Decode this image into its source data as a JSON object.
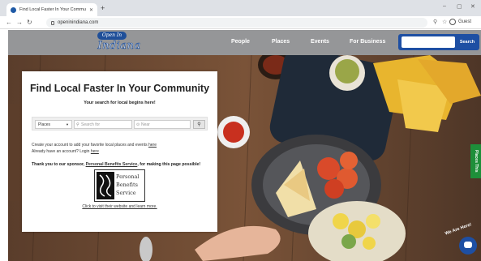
{
  "browser": {
    "tab_title": "Find Local Faster In Your Commu",
    "url": "openinindiana.com",
    "profile_label": "Guest"
  },
  "site": {
    "logo_top": "Open In",
    "logo_word": "Indiana",
    "nav": [
      "People",
      "Places",
      "Events",
      "For Business"
    ],
    "search_placeholder": "",
    "search_button": "Search"
  },
  "card": {
    "title": "Find Local Faster In Your Community",
    "subtitle": "Your search for local begins here!",
    "filter_select": "Places",
    "search_for_placeholder": "Search for",
    "near_placeholder": "Near",
    "info_line1": "Create your account to add your favorite local places and events",
    "info_line1_link": "here",
    "info_line2": "Already have an account? Login",
    "info_line2_link": "here",
    "sponsor_prefix": "Thank you to our sponsor,",
    "sponsor_name": "Personal Benefits Service",
    "sponsor_suffix": ", for making this page possible!",
    "sponsor_logo_lines": [
      "Personal",
      "Benefits",
      "Service"
    ],
    "visit_link": "Click to visit their website and learn more."
  },
  "widgets": {
    "side_tab": "Places This",
    "chat_label": "We Are Here!"
  },
  "colors": {
    "brand_blue": "#1e4fa3",
    "header_gray": "#959698",
    "side_tab_green": "#1e8f3a"
  }
}
